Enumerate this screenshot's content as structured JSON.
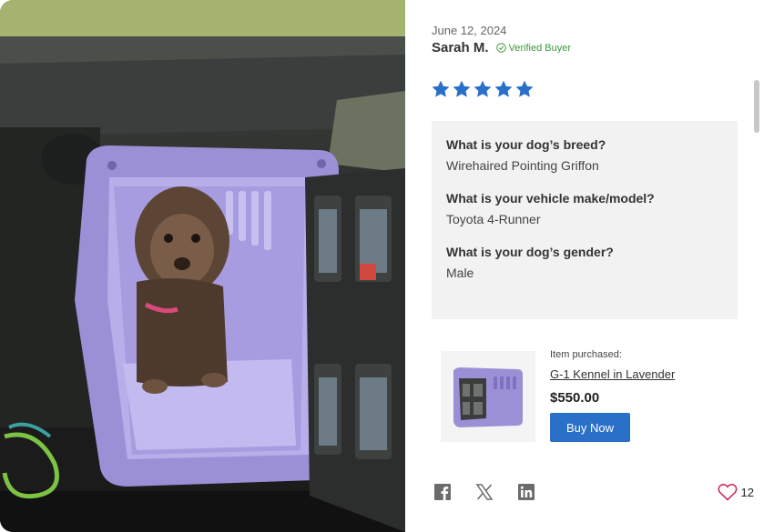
{
  "review": {
    "date": "June 12, 2024",
    "author": "Sarah M.",
    "verified_label": "Verified Buyer",
    "rating": 5,
    "rating_max": 5
  },
  "qa": [
    {
      "question": "What is your dog’s breed?",
      "answer": "Wirehaired Pointing Griffon"
    },
    {
      "question": "What is your vehicle make/model?",
      "answer": "Toyota 4-Runner"
    },
    {
      "question": "What is your dog’s gender?",
      "answer": "Male"
    }
  ],
  "product": {
    "purchased_label": "Item purchased:",
    "name": "G-1 Kennel in Lavender",
    "price": "$550.00",
    "buy_label": "Buy Now"
  },
  "share": {
    "icons": [
      "facebook-icon",
      "x-icon",
      "linkedin-icon"
    ]
  },
  "likes": {
    "count": "12"
  },
  "colors": {
    "star": "#2a70c8",
    "button": "#2a70c8",
    "verified": "#3a9a3a",
    "kennel": "#9b8fd6",
    "qa_bg": "#f2f2f2"
  }
}
